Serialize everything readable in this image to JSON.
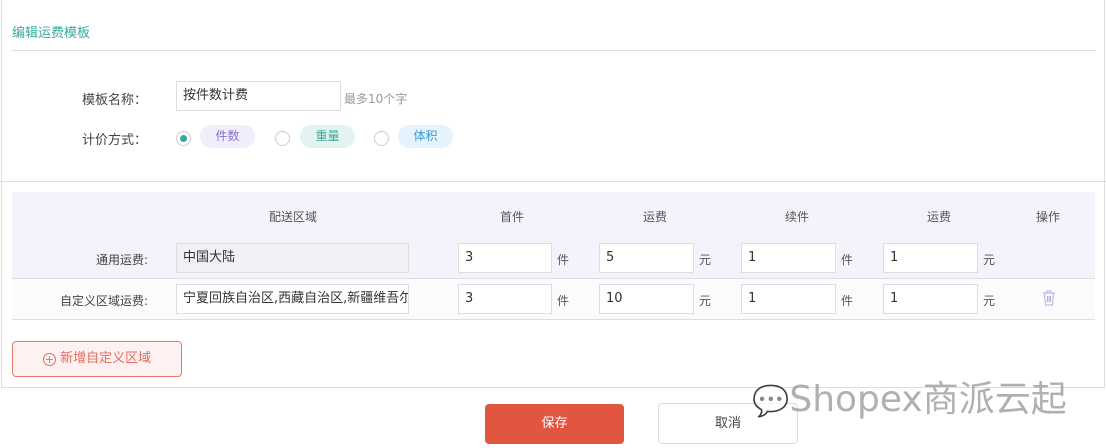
{
  "page": {
    "title": "编辑运费模板"
  },
  "form": {
    "name_label": "模板名称：",
    "name_value": "按件数计费",
    "name_hint": "最多10个字",
    "method_label": "计价方式：",
    "methods": [
      {
        "label": "件数",
        "selected": true,
        "color": "#8a6fcf",
        "bg": "#f1eefb"
      },
      {
        "label": "重量",
        "selected": false,
        "color": "#3aa99a",
        "bg": "#e3f3f0"
      },
      {
        "label": "体积",
        "selected": false,
        "color": "#3a9ad9",
        "bg": "#e6f3fc"
      }
    ]
  },
  "table": {
    "headers": [
      "配送区域",
      "首件",
      "运费",
      "续件",
      "运费",
      "操作"
    ],
    "rows": [
      {
        "label": "通用运费:",
        "area": "中国大陆",
        "first": "3",
        "first_unit": "件",
        "first_fee": "5",
        "fee_unit": "元",
        "extra": "1",
        "extra_unit": "件",
        "extra_fee": "1",
        "extra_fee_unit": "元"
      },
      {
        "label": "自定义区域运费:",
        "area": "宁夏回族自治区,西藏自治区,新疆维吾尔自治区",
        "first": "3",
        "first_unit": "件",
        "first_fee": "10",
        "fee_unit": "元",
        "extra": "1",
        "extra_unit": "件",
        "extra_fee": "1",
        "extra_fee_unit": "元"
      }
    ]
  },
  "actions": {
    "add_region": "新增自定义区域",
    "save": "保存",
    "cancel": "取消"
  },
  "watermark": "Shopex商派云起"
}
